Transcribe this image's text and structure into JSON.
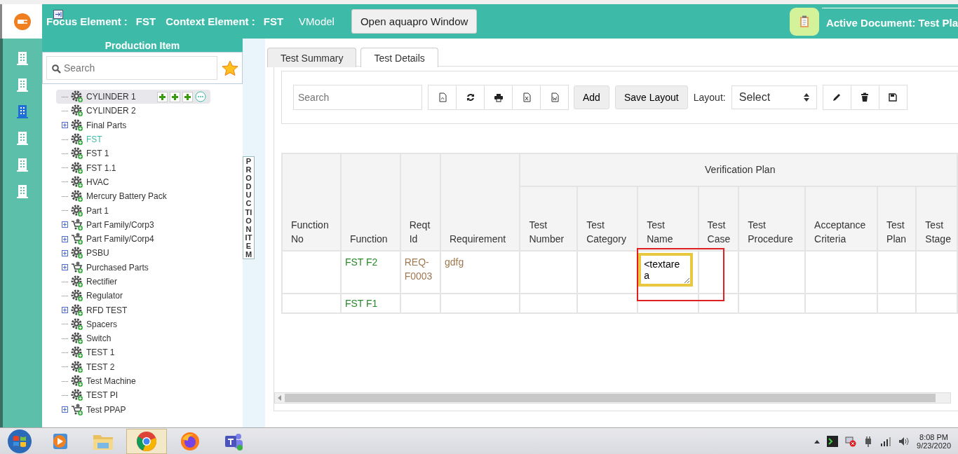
{
  "header": {
    "focus_label": "Focus Element :",
    "focus_value": "FST",
    "context_label": "Context Element :",
    "context_value": "FST",
    "model": "VModel",
    "open_button": "Open aquapro Window",
    "active_document": "Active Document: Test Pla"
  },
  "rail": [
    {
      "selected": false
    },
    {
      "selected": false
    },
    {
      "selected": true
    },
    {
      "selected": false
    },
    {
      "selected": false
    },
    {
      "selected": false
    }
  ],
  "panel": {
    "title": "Production Item",
    "search": {
      "placeholder": "Search"
    },
    "side_tab": "PRODUCTION ITEM",
    "tree": [
      {
        "label": "CYLINDER 1",
        "kind": "gear",
        "expandable": false,
        "selected": true,
        "current": false
      },
      {
        "label": "CYLINDER 2",
        "kind": "gear",
        "expandable": false,
        "selected": false,
        "current": false
      },
      {
        "label": "Final Parts",
        "kind": "gear",
        "expandable": true,
        "selected": false,
        "current": false
      },
      {
        "label": "FST",
        "kind": "gear",
        "expandable": false,
        "selected": false,
        "current": true
      },
      {
        "label": "FST 1",
        "kind": "gear",
        "expandable": false,
        "selected": false,
        "current": false
      },
      {
        "label": "FST 1.1",
        "kind": "gear",
        "expandable": false,
        "selected": false,
        "current": false
      },
      {
        "label": "HVAC",
        "kind": "gear",
        "expandable": false,
        "selected": false,
        "current": false
      },
      {
        "label": "Mercury Battery Pack",
        "kind": "gear",
        "expandable": false,
        "selected": false,
        "current": false
      },
      {
        "label": "Part 1",
        "kind": "gear",
        "expandable": false,
        "selected": false,
        "current": false
      },
      {
        "label": "Part Family/Corp3",
        "kind": "cart",
        "expandable": true,
        "selected": false,
        "current": false
      },
      {
        "label": "Part Family/Corp4",
        "kind": "cart",
        "expandable": true,
        "selected": false,
        "current": false
      },
      {
        "label": "PSBU",
        "kind": "gear",
        "expandable": true,
        "selected": false,
        "current": false
      },
      {
        "label": "Purchased Parts",
        "kind": "cart",
        "expandable": true,
        "selected": false,
        "current": false
      },
      {
        "label": "Rectifier",
        "kind": "gear",
        "expandable": false,
        "selected": false,
        "current": false
      },
      {
        "label": "Regulator",
        "kind": "gear",
        "expandable": false,
        "selected": false,
        "current": false
      },
      {
        "label": "RFD TEST",
        "kind": "gear",
        "expandable": true,
        "selected": false,
        "current": false
      },
      {
        "label": "Spacers",
        "kind": "gear",
        "expandable": false,
        "selected": false,
        "current": false
      },
      {
        "label": "Switch",
        "kind": "gear",
        "expandable": false,
        "selected": false,
        "current": false
      },
      {
        "label": "TEST 1",
        "kind": "gear",
        "expandable": false,
        "selected": false,
        "current": false
      },
      {
        "label": "TEST 2",
        "kind": "gear",
        "expandable": false,
        "selected": false,
        "current": false
      },
      {
        "label": "Test Machine",
        "kind": "gear",
        "expandable": false,
        "selected": false,
        "current": false
      },
      {
        "label": "TEST PI",
        "kind": "gear",
        "expandable": false,
        "selected": false,
        "current": false
      },
      {
        "label": "Test PPAP",
        "kind": "cart",
        "expandable": true,
        "selected": false,
        "current": false
      }
    ]
  },
  "tabs": [
    {
      "label": "Test Summary",
      "selected": false
    },
    {
      "label": "Test Details",
      "selected": true
    }
  ],
  "toolbar": {
    "search": {
      "placeholder": "Search"
    },
    "add": "Add",
    "save_layout": "Save Layout",
    "layout_label": "Layout:",
    "layout_select": "Select"
  },
  "table": {
    "group_header": "Verification Plan",
    "columns": [
      {
        "label": "Function No",
        "grouped": false
      },
      {
        "label": "Function",
        "grouped": false
      },
      {
        "label": "Reqt Id",
        "grouped": false
      },
      {
        "label": "Requirement",
        "grouped": false
      },
      {
        "label": "Test Number",
        "grouped": true
      },
      {
        "label": "Test Category",
        "grouped": true
      },
      {
        "label": "Test Name",
        "grouped": true
      },
      {
        "label": "Test Case",
        "grouped": true
      },
      {
        "label": "Test Procedure",
        "grouped": true
      },
      {
        "label": "Acceptance Criteria",
        "grouped": true
      },
      {
        "label": "Test Plan",
        "grouped": true
      },
      {
        "label": "Test Stage",
        "grouped": true
      }
    ],
    "rows": [
      {
        "function": "FST F2",
        "reqt_id": "REQ-F0003",
        "requirement": "gdfg",
        "test_name_editor": "<textarea"
      },
      {
        "function": "FST F1"
      }
    ]
  },
  "taskbar": {
    "apps": [
      {
        "kind": "media",
        "selected": false
      },
      {
        "kind": "folder",
        "selected": false
      },
      {
        "kind": "chrome",
        "selected": true
      },
      {
        "kind": "firefox",
        "selected": false
      },
      {
        "kind": "teams",
        "selected": false
      }
    ],
    "time": "8:08 PM",
    "date": "9/23/2020"
  }
}
